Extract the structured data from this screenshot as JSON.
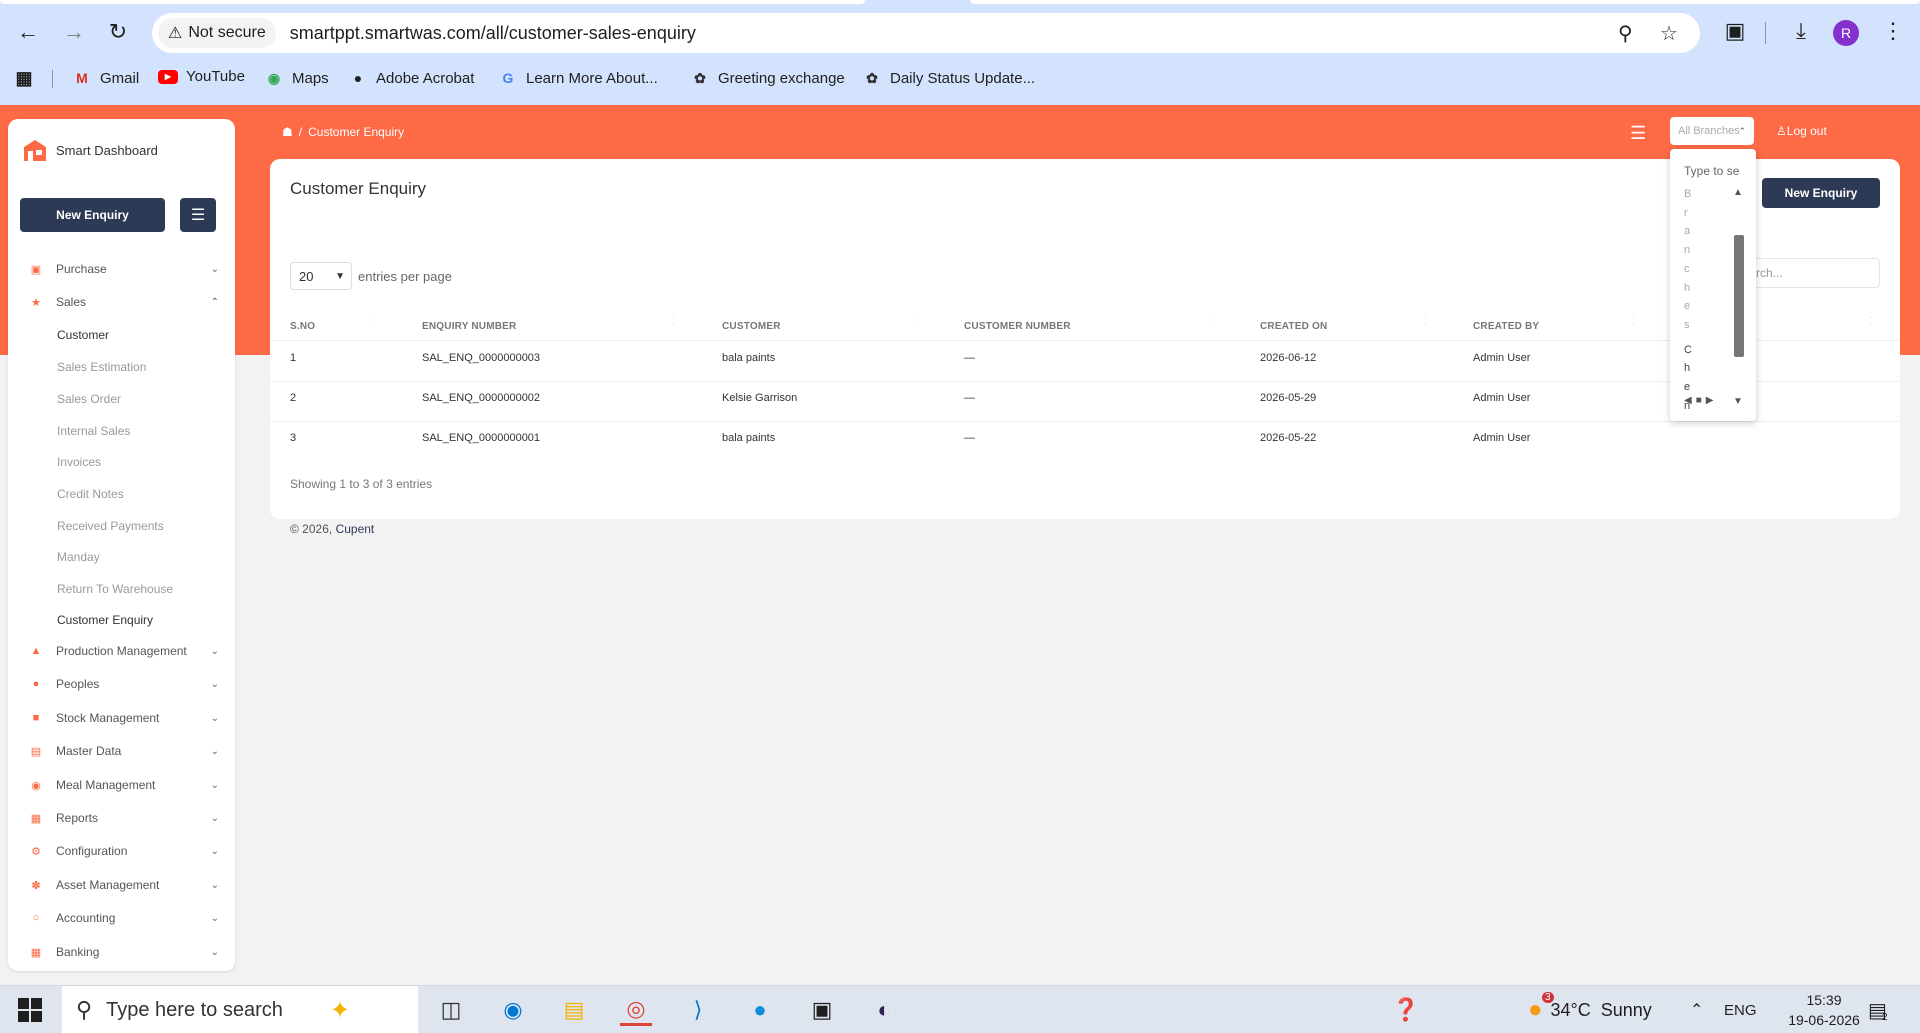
{
  "browser": {
    "not_secure": "Not secure",
    "url": "smartppt.smartwas.com/all/customer-sales-enquiry",
    "profile_initial": "R",
    "bookmarks": [
      "Gmail",
      "YouTube",
      "Maps",
      "Adobe Acrobat",
      "Learn More About...",
      "Greeting exchange",
      "Daily Status Update..."
    ]
  },
  "sidebar": {
    "brand": "Smart Dashboard",
    "new_enquiry": "New Enquiry",
    "items": [
      {
        "label": "Purchase"
      },
      {
        "label": "Sales"
      },
      {
        "label": "Production Management"
      },
      {
        "label": "Peoples"
      },
      {
        "label": "Stock Management"
      },
      {
        "label": "Master Data"
      },
      {
        "label": "Meal Management"
      },
      {
        "label": "Reports"
      },
      {
        "label": "Configuration"
      },
      {
        "label": "Asset Management"
      },
      {
        "label": "Accounting"
      },
      {
        "label": "Banking"
      }
    ],
    "sales_sub": [
      "Customer",
      "Sales Estimation",
      "Sales Order",
      "Internal Sales",
      "Invoices",
      "Credit Notes",
      "Received Payments",
      "Manday",
      "Return To Warehouse",
      "Customer Enquiry"
    ]
  },
  "header": {
    "breadcrumb_sep": "/",
    "breadcrumb": "Customer Enquiry",
    "branch_placeholder": "All Branches",
    "logout": "Log out"
  },
  "dropdown": {
    "search_placeholder": "Type to se",
    "letters_light": [
      "B",
      "r",
      "a",
      "n",
      "c",
      "h",
      "e",
      "s"
    ],
    "letters_dark": [
      "C",
      "h",
      "e",
      "n"
    ]
  },
  "card": {
    "title": "Customer Enquiry",
    "new_enquiry": "New Enquiry",
    "page_size": "20",
    "entries_label": "entries per page",
    "search_placeholder": "rch...",
    "columns": [
      "S.NO",
      "ENQUIRY NUMBER",
      "CUSTOMER",
      "CUSTOMER NUMBER",
      "CREATED ON",
      "CREATED BY"
    ],
    "rows": [
      {
        "sno": "1",
        "enquiry": "SAL_ENQ_0000000003",
        "customer": "bala paints",
        "number": "—",
        "created_on": "2026-06-12",
        "created_by": "Admin User"
      },
      {
        "sno": "2",
        "enquiry": "SAL_ENQ_0000000002",
        "customer": "Kelsie Garrison",
        "number": "—",
        "created_on": "2026-05-29",
        "created_by": "Admin User"
      },
      {
        "sno": "3",
        "enquiry": "SAL_ENQ_0000000001",
        "customer": "bala paints",
        "number": "—",
        "created_on": "2026-05-22",
        "created_by": "Admin User"
      }
    ],
    "showing": "Showing 1 to 3 of 3 entries"
  },
  "footer": {
    "copy": "© 2026,",
    "company": "Cupent"
  },
  "taskbar": {
    "search": "Type here to search",
    "weather_badge": "3",
    "temp": "34°C",
    "weather": "Sunny",
    "lang": "ENG",
    "time": "15:39",
    "date": "19-06-2026",
    "notif_count": "2"
  },
  "colors": {
    "accent": "#fd6a45",
    "primary": "#2d3a56"
  }
}
